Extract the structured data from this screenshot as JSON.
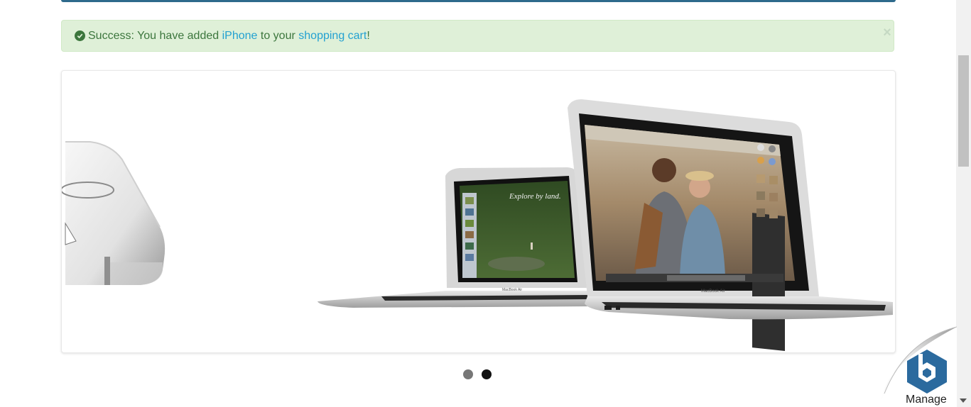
{
  "alert": {
    "prefix": "Success: You have added ",
    "product_link": "iPhone",
    "middle": " to your ",
    "cart_link": "shopping cart",
    "suffix": "!",
    "close_symbol": "×"
  },
  "slideshow": {
    "slides": [
      "iPhone slide",
      "MacBook Air slide"
    ],
    "active_index": 1,
    "image_texts": {
      "explore": "Explore by land.",
      "macbook_label": "MacBook Air"
    }
  },
  "widget": {
    "label": "Manage"
  },
  "colors": {
    "alert_bg": "#dff0d8",
    "alert_text": "#3c763d",
    "link": "#23a1d1",
    "top_bar": "#2e6a8c",
    "manage_icon": "#2b6a9e"
  }
}
